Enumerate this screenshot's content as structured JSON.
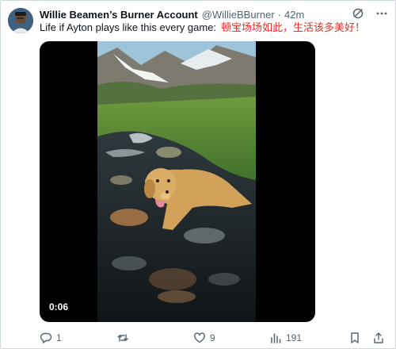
{
  "tweet": {
    "display_name": "Willie Beamen’s Burner Account",
    "handle": "@WillieBBurner",
    "separator": "·",
    "time": "42m",
    "text_en": "Life if Ayton plays like this every game:",
    "text_zh": "顿宝场场如此，生活该多美好！",
    "text_zh_color": "#e0322a"
  },
  "video": {
    "duration": "0:06"
  },
  "actions": {
    "reply_count": "1",
    "retweet_count": "",
    "like_count": "9",
    "views_count": "191"
  },
  "icons": {
    "top_left": "grok-icon",
    "top_right": "more-icon",
    "reply": "reply-icon",
    "retweet": "retweet-icon",
    "like": "heart-icon",
    "views": "views-icon",
    "bookmark": "bookmark-icon",
    "share": "share-icon"
  },
  "colors": {
    "text": "#0f1419",
    "muted": "#536471",
    "border": "#cfd9de"
  }
}
